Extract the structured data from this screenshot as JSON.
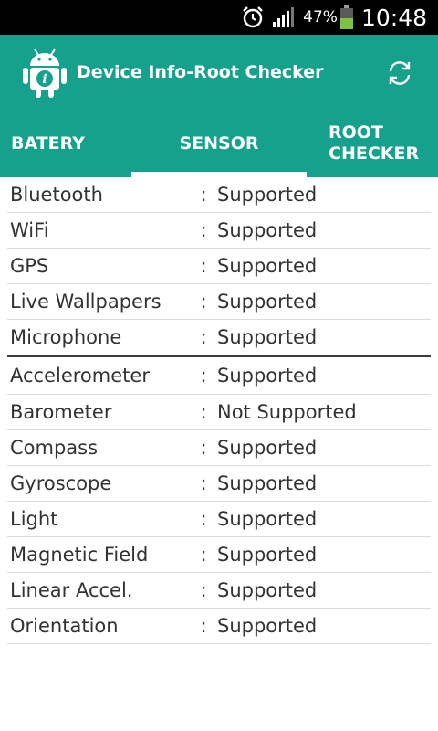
{
  "status_bar": {
    "battery_percent": "47%",
    "time": "10:48"
  },
  "app_bar": {
    "title": "Device Info-Root Checker",
    "accent": "#16a18d"
  },
  "tabs": [
    {
      "label": "BATERY",
      "selected": false
    },
    {
      "label": "SENSOR",
      "selected": true
    },
    {
      "label": "ROOT CHECKER",
      "line1": "ROOT",
      "line2": "CHECKER",
      "selected": false
    }
  ],
  "features": [
    {
      "name": "Bluetooth",
      "sep": ":",
      "value": "Supported"
    },
    {
      "name": "WiFi",
      "sep": ":",
      "value": "Supported"
    },
    {
      "name": "GPS",
      "sep": ":",
      "value": "Supported"
    },
    {
      "name": "Live Wallpapers",
      "sep": ":",
      "value": "Supported"
    },
    {
      "name": "Microphone",
      "sep": ":",
      "value": "Supported"
    }
  ],
  "sensors": [
    {
      "name": "Accelerometer",
      "sep": ":",
      "value": "Supported"
    },
    {
      "name": "Barometer",
      "sep": ":",
      "value": "Not Supported"
    },
    {
      "name": "Compass",
      "sep": ":",
      "value": "Supported"
    },
    {
      "name": "Gyroscope",
      "sep": ":",
      "value": "Supported"
    },
    {
      "name": "Light",
      "sep": ":",
      "value": "Supported"
    },
    {
      "name": "Magnetic Field",
      "sep": ":",
      "value": "Supported"
    },
    {
      "name": "Linear Accel.",
      "sep": ":",
      "value": "Supported"
    },
    {
      "name": "Orientation",
      "sep": ":",
      "value": "Supported"
    }
  ]
}
